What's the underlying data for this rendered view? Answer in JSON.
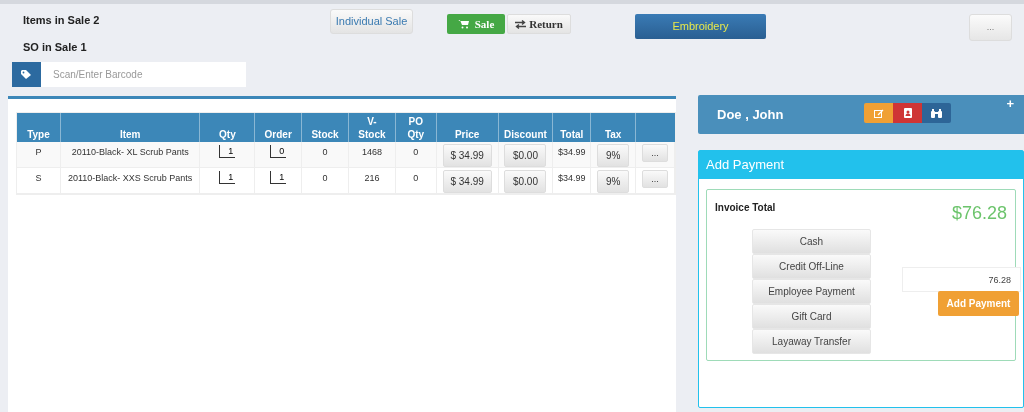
{
  "summary": {
    "items_in_sale": "Items in Sale 2",
    "so_in_sale": "SO in Sale 1"
  },
  "mode_buttons": [
    {
      "label": "Individual Sale",
      "kind": "plain"
    },
    {
      "label": "Sale",
      "kind": "sale"
    },
    {
      "label": "Return",
      "kind": "return"
    },
    {
      "label": "Embroidery",
      "kind": "embroidery"
    }
  ],
  "more_button": "...",
  "barcode": {
    "placeholder": "Scan/Enter Barcode"
  },
  "table": {
    "columns": [
      "Type",
      "Item",
      "Qty",
      "Order",
      "Stock",
      "V-\nStock",
      "PO\nQty",
      "Price",
      "Discount",
      "Total",
      "Tax"
    ],
    "rows": [
      {
        "type": "P",
        "item": "20110-Black- XL Scrub Pants",
        "qty": "1",
        "order": "0",
        "stock": "0",
        "v_stock": "1468",
        "po_qty": "0",
        "price": "$ 34.99",
        "discount": "$0.00",
        "total": "$34.99",
        "tax": "9%",
        "action": "..."
      },
      {
        "type": "S",
        "item": "20110-Black- XXS Scrub Pants",
        "qty": "1",
        "order": "1",
        "stock": "0",
        "v_stock": "216",
        "po_qty": "0",
        "price": "$ 34.99",
        "discount": "$0.00",
        "total": "$34.99",
        "tax": "9%",
        "action": "..."
      }
    ]
  },
  "customer": {
    "name": "Doe , John",
    "plus": "+"
  },
  "payment": {
    "title": "Add Payment",
    "invoice_label": "Invoice Total",
    "invoice_total": "$76.28",
    "methods": [
      "Cash",
      "Credit Off-Line",
      "Employee Payment",
      "Gift Card",
      "Layaway Transfer"
    ],
    "amount": "76.28",
    "add_button": "Add Payment"
  }
}
